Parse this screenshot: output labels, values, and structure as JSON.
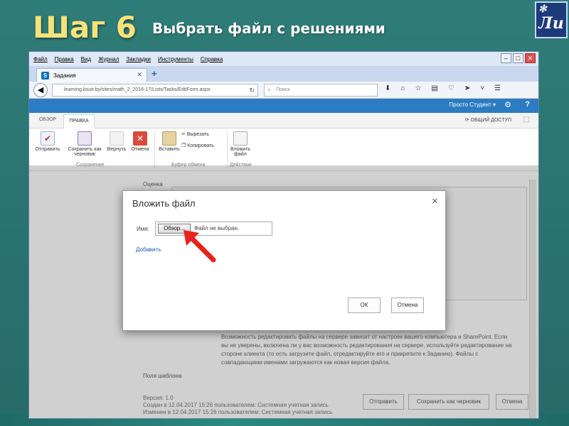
{
  "slide": {
    "title": "Шаг 6",
    "subtitle": "Выбрать файл с решениями",
    "logo_text": "Ли"
  },
  "browser": {
    "menu": [
      "Файл",
      "Правка",
      "Вид",
      "Журнал",
      "Закладки",
      "Инструменты",
      "Справка"
    ],
    "tab_title": "Задания",
    "tab_icon_letter": "S",
    "url": "learning.bsuir.by/sites/math_2_2016-17/Lists/Tasks/EditForm.aspx",
    "search_placeholder": "Поиск"
  },
  "sharepoint": {
    "user": "Просто Студент",
    "ribbon_tabs": [
      "ОБЗОР",
      "ПРАВКА"
    ],
    "share": "ОБЩИЙ ДОСТУП",
    "ribbon": {
      "send": "Отправить",
      "save_draft": "Сохранить как черновик",
      "revert": "Вернуть",
      "cancel": "Отмена",
      "paste": "Вставить",
      "cut": "Вырезать",
      "copy": "Копировать",
      "attach": "Вложить файл",
      "group_save": "Сохранение",
      "group_clipboard": "Буфер обмена",
      "group_actions": "Действия"
    },
    "field_grade": "Оценка",
    "note": "Возможность редактировать файлы на сервере зависит от настроек вашего компьютера и SharePoint. Если вы не уверены, включена ли у вас возможность редактирования на сервере, используйте редактирование на стороне клиента (то есть загрузите файл, отредактируйте его и прикрепите к Заданию). Файлы с совпадающими именами загружаются как новая версия файла.",
    "template_fields": "Поля шаблона",
    "version": "Версия: 1.0",
    "created": "Создан в 12.04.2017 15:26 пользователем:",
    "modified": "Изменен в 12.04.2017 15:26 пользователем:",
    "system_account": "Системная учетная запись",
    "btn_send": "Отправить",
    "btn_save_draft": "Сохранить как черновик",
    "btn_cancel": "Отмена"
  },
  "dialog": {
    "title": "Вложить файл",
    "name_label": "Имя:",
    "browse_label": "Обзор...",
    "no_file": "Файл не выбран.",
    "add_link": "Добавить",
    "ok": "ОК",
    "cancel": "Отмена"
  },
  "colors": {
    "slide_bg": "#2b7470",
    "title_yellow": "#f7e27a",
    "sharepoint_blue": "#2b7cc2",
    "arrow_red": "#e8231c"
  }
}
